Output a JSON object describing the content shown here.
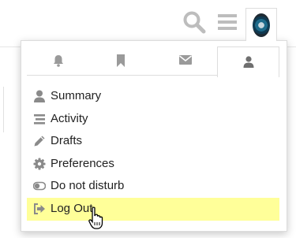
{
  "header": {
    "icons": [
      "search-icon",
      "hamburger-menu-icon",
      "user-avatar"
    ]
  },
  "user_menu": {
    "tabs": [
      {
        "icon": "bell-icon",
        "active": false
      },
      {
        "icon": "bookmark-icon",
        "active": false
      },
      {
        "icon": "envelope-icon",
        "active": false
      },
      {
        "icon": "user-icon",
        "active": true
      }
    ],
    "items": [
      {
        "label": "Summary",
        "icon": "user-icon"
      },
      {
        "label": "Activity",
        "icon": "stream-icon"
      },
      {
        "label": "Drafts",
        "icon": "pencil-icon"
      },
      {
        "label": "Preferences",
        "icon": "cog-icon"
      },
      {
        "label": "Do not disturb",
        "icon": "toggle-off-icon"
      },
      {
        "label": "Log Out",
        "icon": "sign-out-icon",
        "highlighted": true
      }
    ]
  },
  "colors": {
    "icon_gray": "#9a9a9a",
    "menu_icon_gray": "#8a8a8a",
    "highlight": "#ffff99",
    "text": "#222222"
  }
}
